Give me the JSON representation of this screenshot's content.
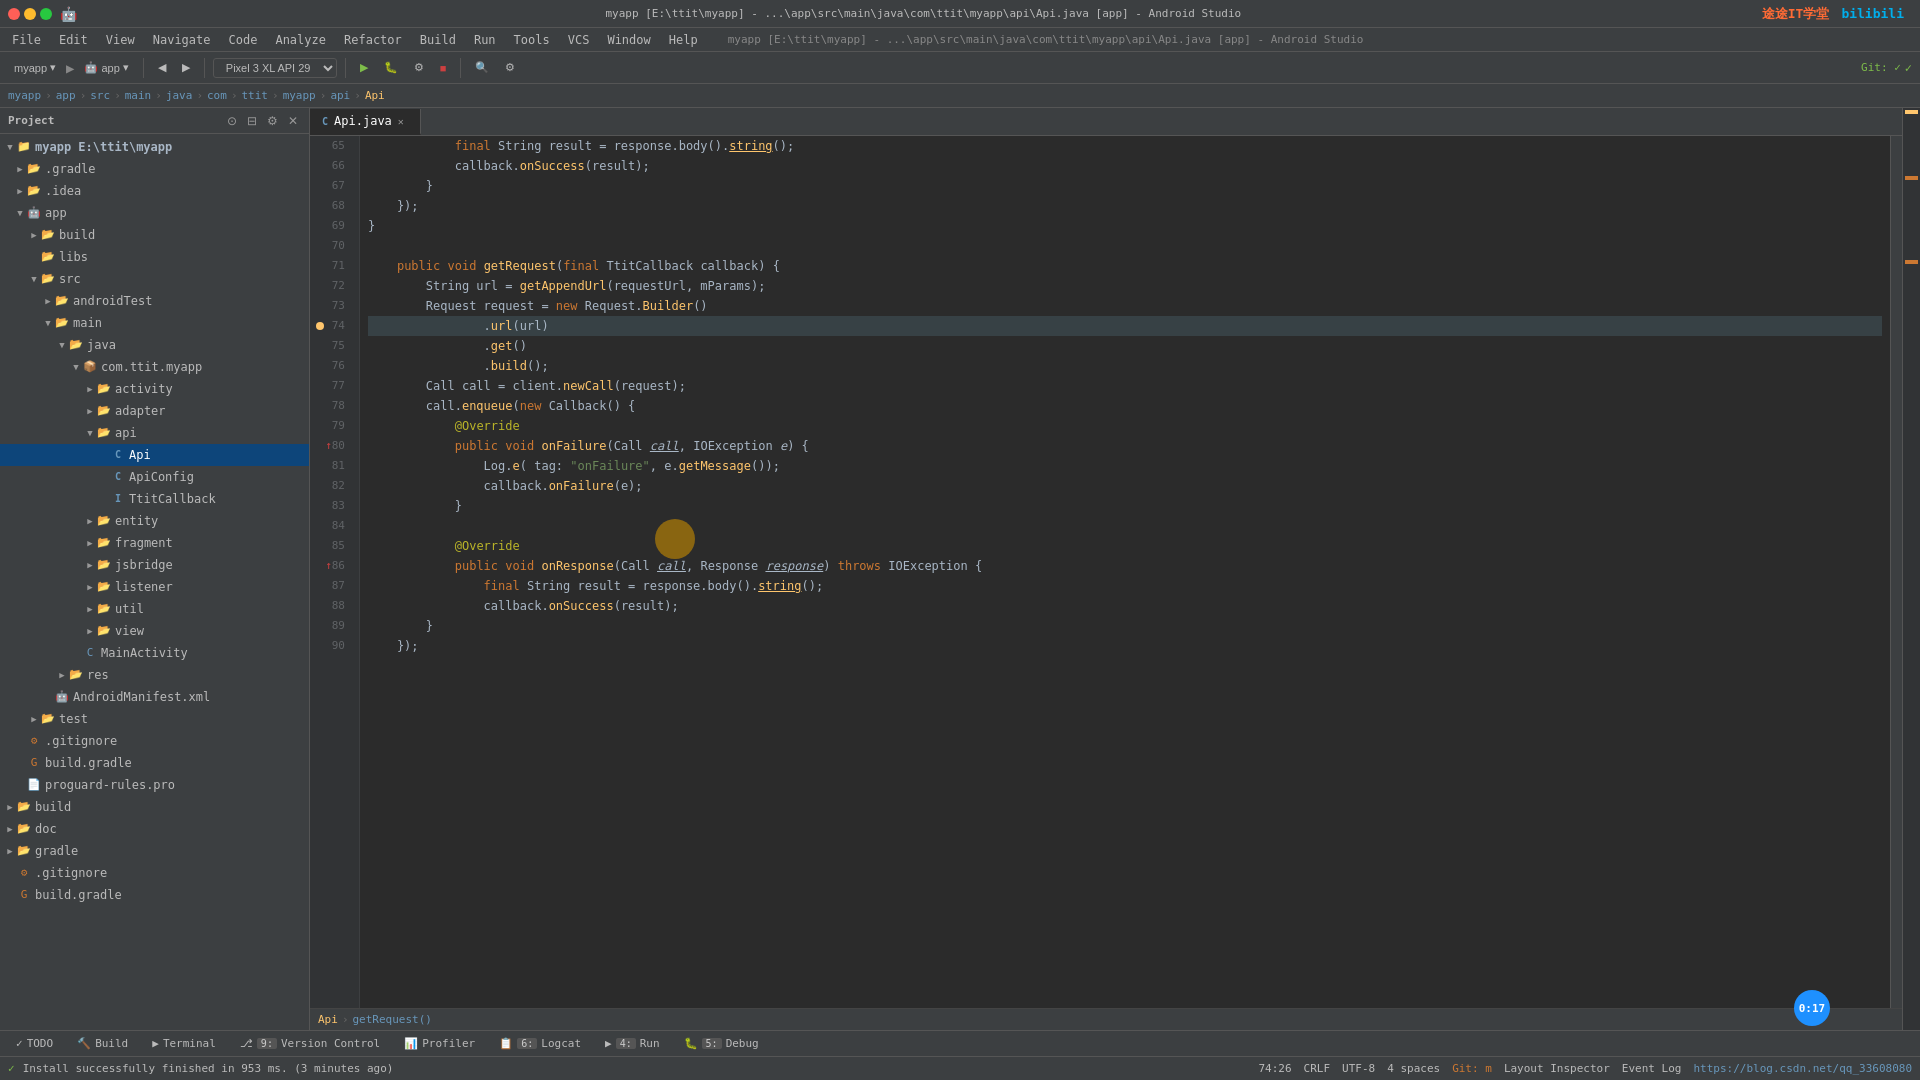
{
  "app": {
    "title": "myapp [E:\\ttit\\myapp] - ...\\app\\src\\main\\java\\com\\ttit\\myapp\\api\\Api.java [app] - Android Studio"
  },
  "menu": {
    "items": [
      "File",
      "Edit",
      "View",
      "Navigate",
      "Code",
      "Analyze",
      "Refactor",
      "Build",
      "Run",
      "Tools",
      "VCS",
      "Window",
      "Help"
    ]
  },
  "toolbar": {
    "project": "myapp",
    "module": "app",
    "device": "Pixel 3 XL API 29",
    "run_label": "▶",
    "debug_label": "🐛",
    "git_label": "Git:"
  },
  "breadcrumb": {
    "parts": [
      "myapp",
      "app",
      "src",
      "main",
      "java",
      "com",
      "ttit",
      "myapp",
      "api",
      "Api"
    ]
  },
  "project_panel": {
    "title": "Project"
  },
  "file_tree": {
    "items": [
      {
        "level": 0,
        "label": "myapp E:\\ttit\\myapp",
        "type": "module",
        "arrow": "open",
        "icon": "module"
      },
      {
        "level": 1,
        "label": ".gradle",
        "type": "folder",
        "arrow": "closed",
        "icon": "folder"
      },
      {
        "level": 1,
        "label": ".idea",
        "type": "folder",
        "arrow": "closed",
        "icon": "folder"
      },
      {
        "level": 1,
        "label": "app",
        "type": "folder",
        "arrow": "open",
        "icon": "folder"
      },
      {
        "level": 2,
        "label": "build",
        "type": "folder",
        "arrow": "closed",
        "icon": "folder",
        "color": "yellow"
      },
      {
        "level": 2,
        "label": "libs",
        "type": "folder",
        "arrow": "leaf",
        "icon": "folder"
      },
      {
        "level": 2,
        "label": "src",
        "type": "folder",
        "arrow": "open",
        "icon": "folder"
      },
      {
        "level": 3,
        "label": "androidTest",
        "type": "folder",
        "arrow": "closed",
        "icon": "folder"
      },
      {
        "level": 3,
        "label": "main",
        "type": "folder",
        "arrow": "open",
        "icon": "folder"
      },
      {
        "level": 4,
        "label": "java",
        "type": "folder",
        "arrow": "open",
        "icon": "folder"
      },
      {
        "level": 5,
        "label": "com.ttit.myapp",
        "type": "package",
        "arrow": "open",
        "icon": "package"
      },
      {
        "level": 6,
        "label": "activity",
        "type": "folder",
        "arrow": "closed",
        "icon": "folder"
      },
      {
        "level": 6,
        "label": "adapter",
        "type": "folder",
        "arrow": "closed",
        "icon": "folder"
      },
      {
        "level": 6,
        "label": "api",
        "type": "folder",
        "arrow": "open",
        "icon": "folder"
      },
      {
        "level": 7,
        "label": "Api",
        "type": "java-class",
        "arrow": "leaf",
        "icon": "java-class",
        "selected": true
      },
      {
        "level": 7,
        "label": "ApiConfig",
        "type": "java-class",
        "arrow": "leaf",
        "icon": "java-class"
      },
      {
        "level": 7,
        "label": "TtitCallback",
        "type": "java-interface",
        "arrow": "leaf",
        "icon": "java-interface"
      },
      {
        "level": 6,
        "label": "entity",
        "type": "folder",
        "arrow": "closed",
        "icon": "folder"
      },
      {
        "level": 6,
        "label": "fragment",
        "type": "folder",
        "arrow": "closed",
        "icon": "folder"
      },
      {
        "level": 6,
        "label": "jsbridge",
        "type": "folder",
        "arrow": "closed",
        "icon": "folder"
      },
      {
        "level": 6,
        "label": "listener",
        "type": "folder",
        "arrow": "closed",
        "icon": "folder"
      },
      {
        "level": 6,
        "label": "util",
        "type": "folder",
        "arrow": "closed",
        "icon": "folder"
      },
      {
        "level": 6,
        "label": "view",
        "type": "folder",
        "arrow": "closed",
        "icon": "folder"
      },
      {
        "level": 5,
        "label": "MainActivity",
        "type": "java-class",
        "arrow": "leaf",
        "icon": "java-class-android"
      },
      {
        "level": 4,
        "label": "res",
        "type": "folder",
        "arrow": "closed",
        "icon": "folder"
      },
      {
        "level": 3,
        "label": "AndroidManifest.xml",
        "type": "xml",
        "arrow": "leaf",
        "icon": "xml"
      },
      {
        "level": 2,
        "label": "test",
        "type": "folder",
        "arrow": "closed",
        "icon": "folder"
      },
      {
        "level": 1,
        "label": ".gitignore",
        "type": "git",
        "arrow": "leaf",
        "icon": "git"
      },
      {
        "level": 1,
        "label": "build.gradle",
        "type": "gradle",
        "arrow": "leaf",
        "icon": "gradle"
      },
      {
        "level": 1,
        "label": "proguard-rules.pro",
        "type": "file",
        "arrow": "leaf",
        "icon": "file"
      },
      {
        "level": 0,
        "label": "build",
        "type": "folder",
        "arrow": "closed",
        "icon": "folder"
      },
      {
        "level": 0,
        "label": "doc",
        "type": "folder",
        "arrow": "closed",
        "icon": "folder"
      },
      {
        "level": 0,
        "label": "gradle",
        "type": "folder",
        "arrow": "closed",
        "icon": "folder"
      },
      {
        "level": 0,
        "label": ".gitignore",
        "type": "git",
        "arrow": "leaf",
        "icon": "git"
      },
      {
        "level": 0,
        "label": "build.gradle",
        "type": "gradle",
        "arrow": "leaf",
        "icon": "gradle"
      }
    ]
  },
  "editor": {
    "tab_label": "Api.java",
    "lines": [
      {
        "num": 65,
        "content": "            final String result = response.body().<u>string</u>();",
        "tokens": [
          {
            "text": "            "
          },
          {
            "text": "final",
            "class": "kw"
          },
          {
            "text": " String result = response.body()."
          },
          {
            "text": "string",
            "class": "fn",
            "underline": true
          },
          {
            "text": "();"
          }
        ]
      },
      {
        "num": 66,
        "content": "            callback.onSuccess(result);",
        "tokens": [
          {
            "text": "            callback."
          },
          {
            "text": "onSuccess",
            "class": "fn"
          },
          {
            "text": "(result);"
          }
        ]
      },
      {
        "num": 67,
        "content": "        }",
        "tokens": [
          {
            "text": "        }"
          }
        ]
      },
      {
        "num": 68,
        "content": "    });",
        "tokens": [
          {
            "text": "    });"
          }
        ]
      },
      {
        "num": 69,
        "content": "}",
        "tokens": [
          {
            "text": "}"
          }
        ]
      },
      {
        "num": 70,
        "content": "",
        "tokens": []
      },
      {
        "num": 71,
        "content": "    public void getRequest(final TtitCallback callback) {",
        "tokens": [
          {
            "text": "    "
          },
          {
            "text": "public",
            "class": "kw"
          },
          {
            "text": " "
          },
          {
            "text": "void",
            "class": "kw"
          },
          {
            "text": " "
          },
          {
            "text": "getRequest",
            "class": "fn"
          },
          {
            "text": "("
          },
          {
            "text": "final",
            "class": "kw"
          },
          {
            "text": " TtitCallback callback) {"
          }
        ]
      },
      {
        "num": 72,
        "content": "        String url = getAppendUrl(requestUrl, mParams);",
        "tokens": [
          {
            "text": "        String url = "
          },
          {
            "text": "getAppendUrl",
            "class": "fn"
          },
          {
            "text": "(requestUrl, mParams);"
          }
        ]
      },
      {
        "num": 73,
        "content": "        Request request = new Request.Builder()",
        "tokens": [
          {
            "text": "        Request request = "
          },
          {
            "text": "new",
            "class": "kw"
          },
          {
            "text": " Request."
          },
          {
            "text": "Builder",
            "class": "class-name"
          },
          {
            "text": "()"
          }
        ]
      },
      {
        "num": 74,
        "content": "                .url(url)",
        "tokens": [
          {
            "text": "                ."
          },
          {
            "text": "url",
            "class": "fn"
          },
          {
            "text": "(url)"
          }
        ],
        "has_indicator": true
      },
      {
        "num": 75,
        "content": "                .get()",
        "tokens": [
          {
            "text": "                ."
          },
          {
            "text": "get",
            "class": "fn"
          },
          {
            "text": "()"
          }
        ]
      },
      {
        "num": 76,
        "content": "                .build();",
        "tokens": [
          {
            "text": "                ."
          },
          {
            "text": "build",
            "class": "fn"
          },
          {
            "text": "();"
          }
        ]
      },
      {
        "num": 77,
        "content": "        Call call = client.newCall(request);",
        "tokens": [
          {
            "text": "        Call call = client."
          },
          {
            "text": "newCall",
            "class": "fn"
          },
          {
            "text": "(request);"
          }
        ]
      },
      {
        "num": 78,
        "content": "        call.enqueue(new Callback() {",
        "tokens": [
          {
            "text": "        call."
          },
          {
            "text": "enqueue",
            "class": "fn"
          },
          {
            "text": "("
          },
          {
            "text": "new",
            "class": "kw"
          },
          {
            "text": " Callback() {"
          }
        ]
      },
      {
        "num": 79,
        "content": "            @Override",
        "tokens": [
          {
            "text": "            "
          },
          {
            "text": "@Override",
            "class": "ann"
          }
        ]
      },
      {
        "num": 80,
        "content": "            public void onFailure(Call call, IOException e) {",
        "tokens": [
          {
            "text": "            "
          },
          {
            "text": "public",
            "class": "kw"
          },
          {
            "text": " "
          },
          {
            "text": "void",
            "class": "kw"
          },
          {
            "text": " "
          },
          {
            "text": "onFailure",
            "class": "fn"
          },
          {
            "text": "(Call "
          },
          {
            "text": "call",
            "class": "local-var"
          },
          {
            "text": ", IOException "
          },
          {
            "text": "e",
            "class": "param"
          },
          {
            "text": ") {"
          }
        ],
        "has_arrow": true
      },
      {
        "num": 81,
        "content": "                Log.e( tag: \"onFailure\", e.getMessage());",
        "tokens": [
          {
            "text": "                Log."
          },
          {
            "text": "e",
            "class": "fn"
          },
          {
            "text": "( tag: "
          },
          {
            "text": "\"onFailure\"",
            "class": "str"
          },
          {
            "text": ", e."
          },
          {
            "text": "getMessage",
            "class": "fn"
          },
          {
            "text": "());"
          }
        ]
      },
      {
        "num": 82,
        "content": "                callback.onFailure(e);",
        "tokens": [
          {
            "text": "                callback."
          },
          {
            "text": "onFailure",
            "class": "fn"
          },
          {
            "text": "(e);"
          }
        ]
      },
      {
        "num": 83,
        "content": "            }",
        "tokens": [
          {
            "text": "            }"
          }
        ]
      },
      {
        "num": 84,
        "content": "",
        "tokens": []
      },
      {
        "num": 85,
        "content": "            @Override",
        "tokens": [
          {
            "text": "            "
          },
          {
            "text": "@Override",
            "class": "ann"
          }
        ]
      },
      {
        "num": 86,
        "content": "            public void onResponse(Call call, Response response) throws IOException {",
        "tokens": [
          {
            "text": "            "
          },
          {
            "text": "public",
            "class": "kw"
          },
          {
            "text": " "
          },
          {
            "text": "void",
            "class": "kw"
          },
          {
            "text": " "
          },
          {
            "text": "onResponse",
            "class": "fn"
          },
          {
            "text": "(Call "
          },
          {
            "text": "call",
            "class": "local-var"
          },
          {
            "text": ", Response "
          },
          {
            "text": "response",
            "class": "local-var"
          },
          {
            "text": ") "
          },
          {
            "text": "throws",
            "class": "kw"
          },
          {
            "text": " IOException {"
          }
        ],
        "has_arrow": true
      },
      {
        "num": 87,
        "content": "                final String result = response.body().string();",
        "tokens": [
          {
            "text": "                "
          },
          {
            "text": "final",
            "class": "kw"
          },
          {
            "text": " String result = response.body()."
          },
          {
            "text": "string",
            "class": "fn"
          },
          {
            "text": "();"
          }
        ]
      },
      {
        "num": 88,
        "content": "                callback.onSuccess(result);",
        "tokens": [
          {
            "text": "                callback."
          },
          {
            "text": "onSuccess",
            "class": "fn"
          },
          {
            "text": "(result);"
          }
        ]
      },
      {
        "num": 89,
        "content": "        }",
        "tokens": [
          {
            "text": "        }"
          }
        ]
      },
      {
        "num": 90,
        "content": "    });",
        "tokens": [
          {
            "text": "    });"
          }
        ]
      }
    ],
    "breadcrumb": {
      "file": "Api",
      "method": "getRequest()"
    }
  },
  "bottom_tabs": [
    {
      "num": "",
      "label": "TODO"
    },
    {
      "num": "",
      "label": "Build"
    },
    {
      "num": "",
      "label": "Terminal"
    },
    {
      "num": "9:",
      "label": "Version Control"
    },
    {
      "num": "",
      "label": "Profiler"
    },
    {
      "num": "6:",
      "label": "Logcat"
    },
    {
      "num": "4:",
      "label": "Run"
    },
    {
      "num": "5:",
      "label": "Debug"
    }
  ],
  "status_bar": {
    "message": "Install successfully finished in 953 ms. (3 minutes ago)",
    "position": "74:26",
    "line_sep": "CRLF",
    "encoding": "UTF-8",
    "indent": "4 spaces",
    "git": "Git: m",
    "layout_inspector": "Layout Inspector",
    "event_log": "Event Log",
    "website": "https://blog.csdn.net/qq_33608080"
  },
  "watermark": {
    "text": "途途IT学堂"
  },
  "timer": {
    "label": "0:17"
  }
}
